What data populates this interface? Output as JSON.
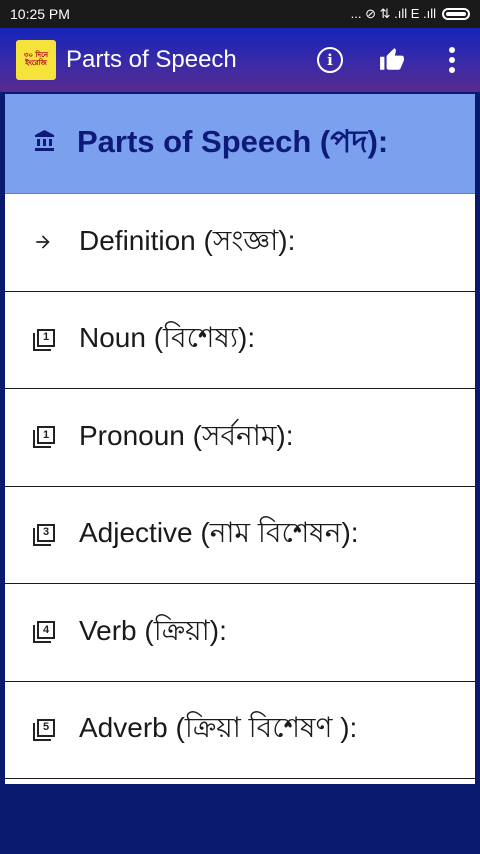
{
  "status_bar": {
    "time": "10:25 PM",
    "indicators": "... ⊘ ⇅ .ıll E .ıll"
  },
  "app_bar": {
    "logo_line1": "৩০ দিনে",
    "logo_line2": "ইংরেজি",
    "title": "Parts of Speech",
    "actions": [
      "info-icon",
      "thumb-up-icon",
      "more-vert-icon"
    ]
  },
  "header": {
    "icon": "bank-icon",
    "label": "Parts of Speech (পদ):"
  },
  "items": [
    {
      "icon": "arrow-right-icon",
      "label": "Definition (সংজ্ঞা):"
    },
    {
      "icon": "filter-1-icon",
      "num": "1",
      "label": "Noun (বিশেষ্য):"
    },
    {
      "icon": "filter-1-icon",
      "num": "1",
      "label": "Pronoun (সর্বনাম):"
    },
    {
      "icon": "filter-3-icon",
      "num": "3",
      "label": "Adjective (নাম বিশেষন):"
    },
    {
      "icon": "filter-4-icon",
      "num": "4",
      "label": "Verb  (ক্রিয়া):"
    },
    {
      "icon": "filter-5-icon",
      "num": "5",
      "label": "Adverb (ক্রিয়া বিশেষণ  ):"
    }
  ],
  "colors": {
    "app_bar_start": "#1524b8",
    "app_bar_end": "#5a2a8e",
    "header_bg": "#7aa0ee",
    "header_text": "#0d1a7a",
    "bottom_bar": "#0a1a6e"
  }
}
